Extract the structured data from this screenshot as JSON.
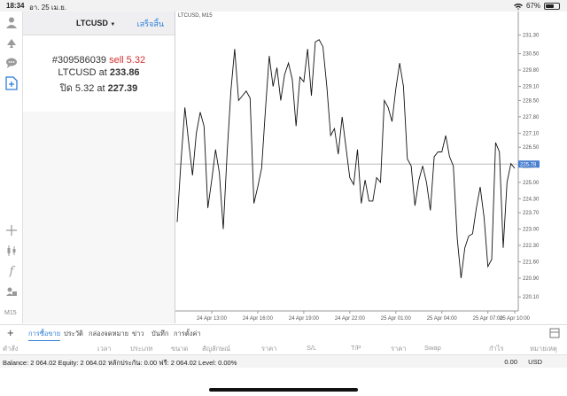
{
  "status": {
    "time": "18:34",
    "date": "อา. 25 เม.ย.",
    "battery": "67%",
    "battery_level": 0.67
  },
  "panel": {
    "symbol": "LTCUSD",
    "done_label": "เสร็จสิ้น",
    "order_id": "#309586039",
    "order_type": "sell 5.32",
    "open_line": "LTCUSD at",
    "open_price": "233.86",
    "close_line": "ปิด 5.32 at",
    "close_price": "227.39"
  },
  "chart": {
    "title": "LTCUSD, M15",
    "current_price_label": "225.78"
  },
  "chart_data": {
    "type": "line",
    "title": "LTCUSD, M15",
    "yticks": [
      220.1,
      220.9,
      221.6,
      222.3,
      223.0,
      223.7,
      224.3,
      225.0,
      225.7,
      226.5,
      227.1,
      227.8,
      228.5,
      229.1,
      229.8,
      230.5,
      231.3
    ],
    "xticks": [
      "24 Apr 13:00",
      "24 Apr 16:00",
      "24 Apr 19:00",
      "24 Apr 22:00",
      "25 Apr 01:00",
      "25 Apr 04:00",
      "25 Apr 07:00",
      "25 Apr 10:00"
    ],
    "ylim": [
      219.5,
      232.0
    ],
    "current_price": 225.78,
    "values": [
      223.3,
      225.9,
      228.2,
      226.7,
      225.3,
      227.1,
      228.0,
      227.4,
      223.9,
      225.1,
      226.4,
      225.4,
      223.0,
      226.2,
      228.9,
      230.7,
      228.5,
      228.7,
      228.9,
      228.6,
      224.1,
      224.8,
      225.6,
      228.1,
      230.4,
      229.1,
      229.9,
      228.5,
      229.6,
      230.1,
      229.4,
      227.4,
      229.5,
      229.3,
      230.7,
      228.7,
      231.0,
      231.1,
      230.8,
      229.1,
      227.0,
      227.3,
      226.2,
      227.8,
      226.5,
      225.2,
      224.9,
      226.4,
      224.1,
      225.1,
      224.2,
      224.2,
      225.2,
      225.0,
      228.5,
      228.2,
      227.6,
      229.0,
      230.1,
      229.1,
      226.0,
      225.7,
      224.0,
      225.1,
      225.7,
      225.0,
      223.8,
      226.1,
      226.3,
      226.3,
      227.0,
      226.1,
      225.7,
      222.6,
      220.9,
      222.2,
      222.7,
      222.8,
      223.9,
      224.8,
      223.5,
      221.4,
      221.7,
      226.7,
      226.3,
      222.2,
      225.0,
      225.8,
      225.6
    ]
  },
  "tabs": [
    "การซื้อขาย",
    "ประวัติ",
    "กล่องจดหมาย",
    "ข่าว",
    "บันทึก",
    "การตั้งค่า"
  ],
  "columns": [
    "คำสั่ง",
    "เวลา",
    "ประเภท",
    "ขนาด",
    "สัญลักษณ์",
    "ราคา",
    "S/L",
    "T/P",
    "ราคา",
    "Swap",
    "กำไร",
    "หมายเหตุ"
  ],
  "balance": {
    "text": "Balance: 2 064.02  Equity: 2 064.02  หลักประกัน: 0.00  ฟรี: 2 064.02  Level: 0.00%",
    "profit": "0.00",
    "currency": "USD"
  },
  "left_toolbar": {
    "timeframe": "M15"
  },
  "colors": {
    "accent": "#2f7fd8",
    "sell": "#d0312d"
  }
}
